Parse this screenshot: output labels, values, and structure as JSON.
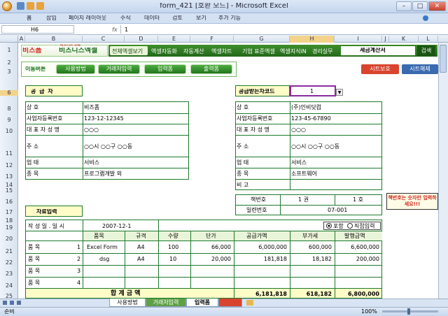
{
  "window": {
    "title": "form_421 [호환 모드] - Microsoft Excel",
    "minimize": "–",
    "maximize": "□",
    "close": "✕"
  },
  "ribbon": {
    "tabs": [
      "홈",
      "삽입",
      "페이지 레이아웃",
      "수식",
      "데이터",
      "검토",
      "보기",
      "추가 기능"
    ]
  },
  "formula_bar": {
    "name_box": "H6",
    "fx": "fx",
    "value": "1"
  },
  "columns": [
    "A",
    "B",
    "C",
    "D",
    "E",
    "F",
    "G",
    "H",
    "I",
    "J",
    "K",
    "L"
  ],
  "rows": [
    "1",
    "2",
    "3",
    "",
    "",
    "6",
    "",
    "8",
    "9",
    "10",
    "",
    "11",
    "12",
    "13",
    "14",
    "15",
    "16",
    "17",
    "18",
    "19",
    "20",
    "21",
    "22",
    "23",
    "24",
    "25"
  ],
  "brand": {
    "logo": "비즈폼",
    "logo2": "비즈니스엑셀",
    "slogan": "비즈니스 프로"
  },
  "nav": {
    "items": [
      "전체엑셀보기",
      "엑셀자동화",
      "자동계산",
      "엑셀차트",
      "기업 표준엑셀",
      "엑셀지식iN",
      "경리실무"
    ],
    "search_value": "세금계산서",
    "search_button": "검색"
  },
  "move_buttons": {
    "label": "이동버튼",
    "items": [
      "사용방법",
      "거래처입력",
      "입력폼",
      "출력폼"
    ],
    "protect": "시트보호",
    "unprotect": "시트해제"
  },
  "supplier": {
    "title": "공  급  자",
    "rows": [
      {
        "label": "상              호",
        "value": "비즈폼"
      },
      {
        "label": "사업자등록번호",
        "value": "123-12-12345"
      },
      {
        "label": "대 표 자 성 명",
        "value": "○○○"
      },
      {
        "label": "주              소",
        "value": "○○시 ○○구 ○○동"
      },
      {
        "label": "업              태",
        "value": "서비스"
      },
      {
        "label": "종              목",
        "value": "프로그램개발 외"
      }
    ]
  },
  "buyer": {
    "code_label": "공급받는자코드",
    "code_value": "1",
    "rows": [
      {
        "label": "상              호",
        "value": "(주)인비닷컴"
      },
      {
        "label": "사업자등록번호",
        "value": "123-45-67890"
      },
      {
        "label": "대 표 자 성 명",
        "value": "○○○"
      },
      {
        "label": "주              소",
        "value": "○○시 ○○구 ○○동"
      },
      {
        "label": "업              태",
        "value": "서비스"
      },
      {
        "label": "종              목",
        "value": "소프트웨어"
      },
      {
        "label": "비              고",
        "value": ""
      }
    ]
  },
  "book": {
    "book_label": "책번호",
    "vol": "1 권",
    "no": "1 호",
    "serial_label": "일련번호",
    "serial": "07-001",
    "note": "책번호는 숫자만 입력하세요!!!"
  },
  "entry": {
    "title": "자료입력",
    "date_label": "작 성 일 . 일 시",
    "date": "2007-12-1",
    "opt1": "포함",
    "opt2": "직접입력",
    "headers": [
      "품목",
      "규격",
      "수량",
      "단가",
      "공급가액",
      "부가세",
      "발행금액"
    ],
    "rows": [
      {
        "label": "품    목",
        "n": "1",
        "item": "Excel Form",
        "spec": "A4",
        "qty": "100",
        "price": "66,000",
        "supply": "6,000,000",
        "vat": "600,000",
        "total": "6,600,000"
      },
      {
        "label": "품    목",
        "n": "2",
        "item": "dsg",
        "spec": "A4",
        "qty": "10",
        "price": "20,000",
        "supply": "181,818",
        "vat": "18,182",
        "total": "200,000"
      },
      {
        "label": "품    목",
        "n": "3",
        "item": "",
        "spec": "",
        "qty": "",
        "price": "",
        "supply": "",
        "vat": "",
        "total": ""
      },
      {
        "label": "품    목",
        "n": "4",
        "item": "",
        "spec": "",
        "qty": "",
        "price": "",
        "supply": "",
        "vat": "",
        "total": ""
      }
    ],
    "sum_label": "합 계 금 액",
    "sum_supply": "6,181,818",
    "sum_vat": "618,182",
    "sum_total": "6,800,000"
  },
  "sheet_tabs": [
    "사용방법",
    "거래처입력",
    "입력폼"
  ],
  "status": {
    "ready": "준비",
    "zoom": "100%"
  },
  "colors": {
    "green": "#1c7a2c",
    "nav": "#2f7f1f",
    "yellow": "#fffcc8",
    "header": "#e9f5d8"
  }
}
